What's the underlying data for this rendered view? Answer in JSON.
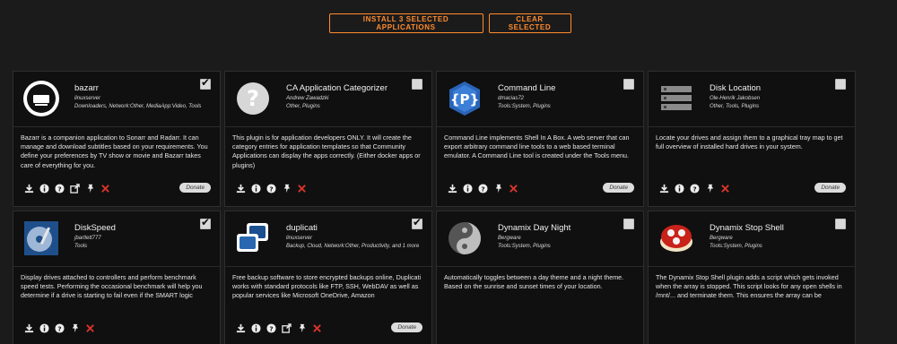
{
  "top_actions": {
    "install_label": "INSTALL 3 SELECTED APPLICATIONS",
    "clear_label": "CLEAR SELECTED"
  },
  "cards": [
    {
      "title": "bazarr",
      "author": "linuxserver",
      "categories": "Downloaders, Network:Other, MediaApp:Video, Tools",
      "description": "Bazarr is a companion application to Sonarr and Radarr. It can manage and download subtitles based on your requirements. You define your preferences by TV show or movie and Bazarr takes care of everything for you.",
      "checked": true,
      "icon": "bazarr-logo-icon",
      "actions": [
        "install-icon",
        "info-icon",
        "help-icon",
        "external-link-icon",
        "pin-icon",
        "remove-icon"
      ],
      "donate_label": "Donate"
    },
    {
      "title": "CA Application Categorizer",
      "author": "Andrew Zawadzki",
      "categories": "Other, Plugins",
      "description": "This plugin is for application developers ONLY. It will create the category entries for application templates so that Community Applications can display the apps correctly. (Either docker apps or plugins)",
      "checked": false,
      "icon": "question-mark-icon",
      "actions": [
        "install-icon",
        "info-icon",
        "help-icon",
        "pin-icon",
        "remove-icon"
      ],
      "donate_label": ""
    },
    {
      "title": "Command Line",
      "author": "dmacias72",
      "categories": "Tools:System, Plugins",
      "description": "Command Line implements Shell In A Box. A web server that can export arbitrary command line tools to a web based terminal emulator. A Command Line tool is created under the Tools menu.",
      "checked": false,
      "icon": "command-line-logo-icon",
      "actions": [
        "install-icon",
        "info-icon",
        "help-icon",
        "pin-icon",
        "remove-icon"
      ],
      "donate_label": "Donate"
    },
    {
      "title": "Disk Location",
      "author": "Ole-Henrik Jakobsen",
      "categories": "Other, Tools, Plugins",
      "description": "Locate your drives and assign them to a graphical tray map to get full overview of installed hard drives in your system.",
      "checked": false,
      "icon": "disk-rack-icon",
      "actions": [
        "install-icon",
        "info-icon",
        "help-icon",
        "pin-icon",
        "remove-icon"
      ],
      "donate_label": "Donate"
    },
    {
      "title": "DiskSpeed",
      "author": "jbartlett777",
      "categories": "Tools",
      "description": "Display drives attached to controllers and perform benchmark speed tests. Performing the occasional benchmark will help you determine if a drive is starting to fail even if the SMART logic",
      "checked": true,
      "icon": "hard-drive-icon",
      "actions": [
        "install-icon",
        "info-icon",
        "help-icon",
        "pin-icon",
        "remove-icon"
      ],
      "donate_label": ""
    },
    {
      "title": "duplicati",
      "author": "linuxserver",
      "categories": "Backup, Cloud, Network:Other, Productivity, and 1 more",
      "description": "Free backup software to store encrypted backups online, Duplicati works with standard protocols like FTP, SSH, WebDAV as well as popular services like Microsoft OneDrive, Amazon",
      "checked": true,
      "icon": "duplicati-logo-icon",
      "actions": [
        "install-icon",
        "info-icon",
        "help-icon",
        "external-link-icon",
        "pin-icon",
        "remove-icon"
      ],
      "donate_label": "Donate"
    },
    {
      "title": "Dynamix Day Night",
      "author": "Bergware",
      "categories": "Tools:System, Plugins",
      "description": "Automatically toggles between a day theme and a night theme. Based on the sunrise and sunset times of your location.",
      "checked": false,
      "icon": "yin-yang-icon",
      "actions": [],
      "donate_label": ""
    },
    {
      "title": "Dynamix Stop Shell",
      "author": "Bergware",
      "categories": "Tools:System, Plugins",
      "description": "The Dynamix Stop Shell plugin adds a script which gets invoked when the array is stopped. This script looks for any open shells in /mnt/... and terminate them. This ensures the array can be",
      "checked": false,
      "icon": "red-shell-icon",
      "actions": [],
      "donate_label": ""
    }
  ]
}
